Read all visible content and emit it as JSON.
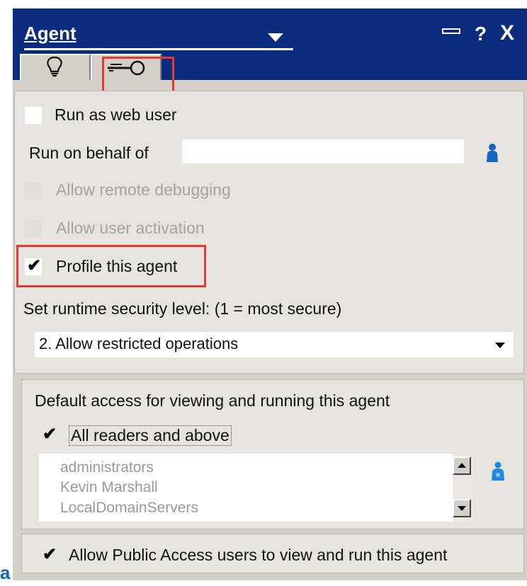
{
  "header": {
    "title": "Agent",
    "icons": [
      "minimize-icon",
      "help-icon",
      "close-icon"
    ],
    "help_glyph": "?",
    "close_glyph": "X",
    "bg_color": "#0a2b7e"
  },
  "tabs": [
    {
      "name": "basics",
      "icon": "lightbulb-icon"
    },
    {
      "name": "security",
      "icon": "key-icon",
      "selected": true
    }
  ],
  "security": {
    "run_as_web_user": {
      "label": "Run as web user",
      "checked": false
    },
    "run_on_behalf": {
      "label": "Run on behalf of",
      "value": ""
    },
    "allow_remote_debugging": {
      "label": "Allow remote debugging",
      "checked": false,
      "disabled": true
    },
    "allow_user_activation": {
      "label": "Allow user activation",
      "checked": false,
      "disabled": true
    },
    "profile_agent": {
      "label": "Profile this agent",
      "checked": true
    },
    "security_level_label": "Set runtime security level: (1 = most secure)",
    "security_level_value": "2. Allow restricted operations"
  },
  "access": {
    "title": "Default access for viewing and running this agent",
    "all_readers": {
      "label": "All readers and above",
      "checked": true
    },
    "readers": [
      "administrators",
      "Kevin Marshall",
      "LocalDomainServers"
    ],
    "public_access": {
      "label": "Allow Public Access users to view and run this agent",
      "checked": true
    }
  },
  "check_glyph": "✔",
  "edge_text": "a",
  "colors": {
    "highlight": "#e53935",
    "dialog_bg": "#d4d0c8",
    "people_icon": "#1565c0"
  }
}
